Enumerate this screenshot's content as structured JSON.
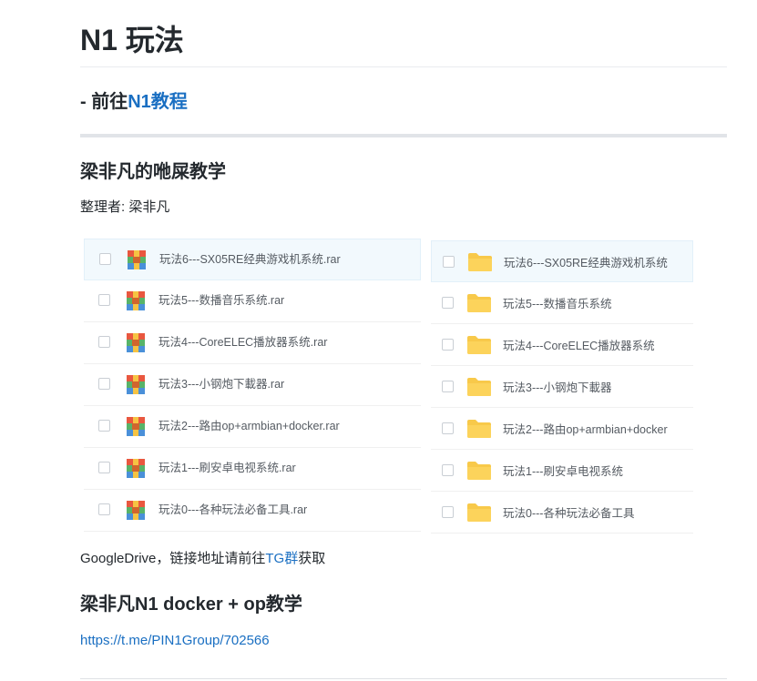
{
  "title": "N1 玩法",
  "goto": {
    "prefix": "- 前往",
    "link": "N1教程"
  },
  "section1": {
    "heading": "梁非凡的咃屎教学",
    "organizer": "整理者: 梁非凡",
    "rar_files": [
      "玩法6---SX05RE经典游戏机系统.rar",
      "玩法5---数播音乐系统.rar",
      "玩法4---CoreELEC播放器系统.rar",
      "玩法3---小钢炮下載器.rar",
      "玩法2---路由op+armbian+docker.rar",
      "玩法1---刷安卓电视系统.rar",
      "玩法0---各种玩法必备工具.rar"
    ],
    "folders": [
      "玩法6---SX05RE经典游戏机系统",
      "玩法5---数播音乐系统",
      "玩法4---CoreELEC播放器系统",
      "玩法3---小钢炮下載器",
      "玩法2---路由op+armbian+docker",
      "玩法1---刷安卓电视系统",
      "玩法0---各种玩法必备工具"
    ],
    "note_prefix": "GoogleDrive，链接地址请前往",
    "note_link": "TG群",
    "note_suffix": "获取"
  },
  "section2": {
    "heading": "梁非凡N1 docker + op教学",
    "link": "https://t.me/PIN1Group/702566"
  },
  "colors": {
    "link": "#1a6fc2",
    "folder": "#f8c94a",
    "selected_row": "#f2f9fd"
  },
  "icons": {
    "archive": "rar-archive-icon",
    "folder": "folder-icon",
    "checkbox": "checkbox"
  }
}
